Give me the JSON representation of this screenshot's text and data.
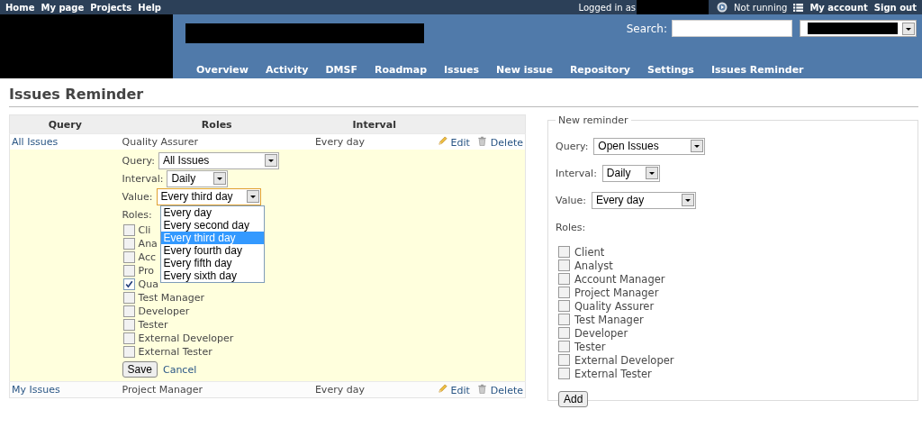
{
  "top_menu": [
    {
      "label": "Home"
    },
    {
      "label": "My page"
    },
    {
      "label": "Projects"
    },
    {
      "label": "Help"
    }
  ],
  "account": {
    "logged_in_label": "Logged in as",
    "status": "Not running",
    "links": [
      "My account",
      "Sign out"
    ]
  },
  "search": {
    "label": "Search:"
  },
  "main_menu": [
    {
      "label": "Overview"
    },
    {
      "label": "Activity"
    },
    {
      "label": "DMSF"
    },
    {
      "label": "Roadmap"
    },
    {
      "label": "Issues"
    },
    {
      "label": "New issue"
    },
    {
      "label": "Repository"
    },
    {
      "label": "Settings"
    },
    {
      "label": "Issues Reminder"
    }
  ],
  "page_title": "Issues Reminder",
  "table": {
    "columns": [
      "Query",
      "Roles",
      "Interval"
    ],
    "rows": [
      {
        "query": "All Issues",
        "roles": "Quality Assurer",
        "interval": "Every day",
        "actions": [
          "Edit",
          "Delete"
        ],
        "editing": true
      },
      {
        "query": "My Issues",
        "roles": "Project Manager",
        "interval": "Every day",
        "actions": [
          "Edit",
          "Delete"
        ],
        "editing": false
      }
    ]
  },
  "edit_form": {
    "query_label": "Query:",
    "query": "All Issues",
    "interval_label": "Interval:",
    "interval": "Daily",
    "value_label": "Value:",
    "value": "Every third day",
    "value_options": [
      {
        "label": "Every day",
        "selected": false
      },
      {
        "label": "Every second day",
        "selected": false
      },
      {
        "label": "Every third day",
        "selected": true
      },
      {
        "label": "Every fourth day",
        "selected": false
      },
      {
        "label": "Every fifth day",
        "selected": false
      },
      {
        "label": "Every sixth day",
        "selected": false
      }
    ],
    "roles_label": "Roles:",
    "roles": [
      {
        "label": "Cli",
        "checked": false
      },
      {
        "label": "Ana",
        "checked": false
      },
      {
        "label": "Acc",
        "checked": false
      },
      {
        "label": "Pro",
        "checked": false
      },
      {
        "label": "Qua",
        "checked": true
      },
      {
        "label": "Test Manager",
        "checked": false
      },
      {
        "label": "Developer",
        "checked": false
      },
      {
        "label": "Tester",
        "checked": false
      },
      {
        "label": "External Developer",
        "checked": false
      },
      {
        "label": "External Tester",
        "checked": false
      }
    ],
    "save": "Save",
    "cancel": "Cancel"
  },
  "new_reminder": {
    "legend": "New reminder",
    "query_label": "Query:",
    "query": "Open Issues",
    "interval_label": "Interval:",
    "interval": "Daily",
    "value_label": "Value:",
    "value": "Every day",
    "roles_label": "Roles:",
    "roles": [
      {
        "label": "Client",
        "checked": false
      },
      {
        "label": "Analyst",
        "checked": false
      },
      {
        "label": "Account Manager",
        "checked": false
      },
      {
        "label": "Project Manager",
        "checked": false
      },
      {
        "label": "Quality Assurer",
        "checked": false
      },
      {
        "label": "Test Manager",
        "checked": false
      },
      {
        "label": "Developer",
        "checked": false
      },
      {
        "label": "Tester",
        "checked": false
      },
      {
        "label": "External Developer",
        "checked": false
      },
      {
        "label": "External Tester",
        "checked": false
      }
    ],
    "add": "Add"
  }
}
